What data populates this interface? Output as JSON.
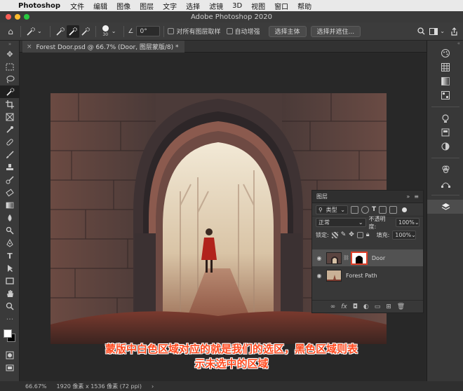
{
  "menubar": {
    "app": "Photoshop",
    "items": [
      "文件",
      "编辑",
      "图像",
      "图层",
      "文字",
      "选择",
      "滤镜",
      "3D",
      "视图",
      "窗口",
      "帮助"
    ]
  },
  "titlebar": {
    "title": "Adobe Photoshop 2020"
  },
  "options": {
    "brush_size": "30",
    "angle": "0°",
    "sample_all": "对所有图层取样",
    "auto_enhance": "自动增强",
    "select_subject": "选择主体",
    "select_mask": "选择并遮住..."
  },
  "document": {
    "tab_title": "Forest Door.psd @ 66.7% (Door, 图层蒙版/8) *"
  },
  "layers_panel": {
    "title": "图层",
    "filter_kind": "类型",
    "blend_mode": "正常",
    "opacity_label": "不透明度:",
    "opacity": "100%",
    "lock_label": "锁定:",
    "fill_label": "填充:",
    "fill": "100%",
    "layers": [
      {
        "name": "Door"
      },
      {
        "name": "Forest Path"
      }
    ]
  },
  "caption": {
    "line1": "蒙版中白色区域对应的就是我们的选区，黑色区域则表",
    "line2": "示未选中的区域"
  },
  "status": {
    "zoom": "66.67%",
    "doc_size": "1920 像素 x 1536 像素 (72 ppi)"
  },
  "colors": {
    "accent": "#ff4a1f",
    "mask_highlight": "#e0402a"
  }
}
